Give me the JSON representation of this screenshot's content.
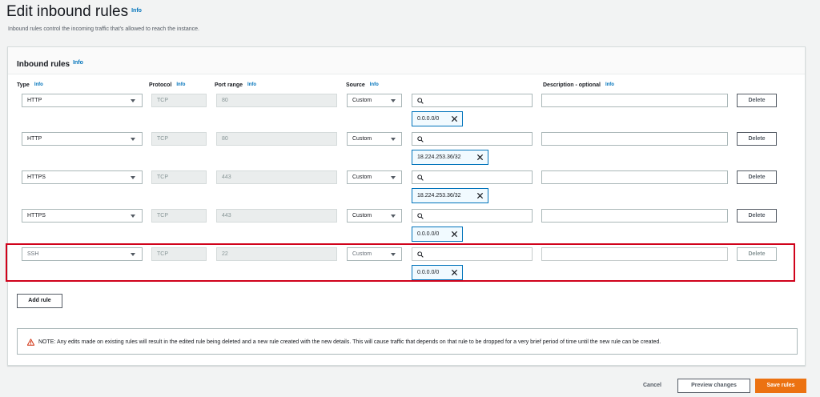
{
  "header": {
    "title": "Edit inbound rules",
    "info": "Info",
    "subtitle": "Inbound rules control the incoming traffic that's allowed to reach the instance."
  },
  "panel": {
    "title": "Inbound rules",
    "info": "Info"
  },
  "columns": {
    "type": "Type",
    "protocol": "Protocol",
    "port_range": "Port range",
    "source": "Source",
    "description": "Description - optional",
    "info": "Info"
  },
  "rules": [
    {
      "type": "HTTP",
      "protocol": "TCP",
      "port": "80",
      "source": "Custom",
      "cidr": "0.0.0.0/0",
      "delete": "Delete"
    },
    {
      "type": "HTTP",
      "protocol": "TCP",
      "port": "80",
      "source": "Custom",
      "cidr": "18.224.253.36/32",
      "delete": "Delete"
    },
    {
      "type": "HTTPS",
      "protocol": "TCP",
      "port": "443",
      "source": "Custom",
      "cidr": "18.224.253.36/32",
      "delete": "Delete"
    },
    {
      "type": "HTTPS",
      "protocol": "TCP",
      "port": "443",
      "source": "Custom",
      "cidr": "0.0.0.0/0",
      "delete": "Delete"
    },
    {
      "type": "SSH",
      "protocol": "TCP",
      "port": "22",
      "source": "Custom",
      "cidr": "0.0.0.0/0",
      "delete": "Delete"
    }
  ],
  "actions": {
    "add_rule": "Add rule",
    "cancel": "Cancel",
    "preview": "Preview changes",
    "save": "Save rules"
  },
  "notice": {
    "text": "NOTE: Any edits made on existing rules will result in the edited rule being deleted and a new rule created with the new details. This will cause traffic that depends on that rule to be dropped for a very brief period of time until the new rule can be created."
  },
  "colors": {
    "accent": "#0073bb",
    "primary_button": "#ec7211",
    "highlight": "#d0021b",
    "warning": "#d13212"
  }
}
